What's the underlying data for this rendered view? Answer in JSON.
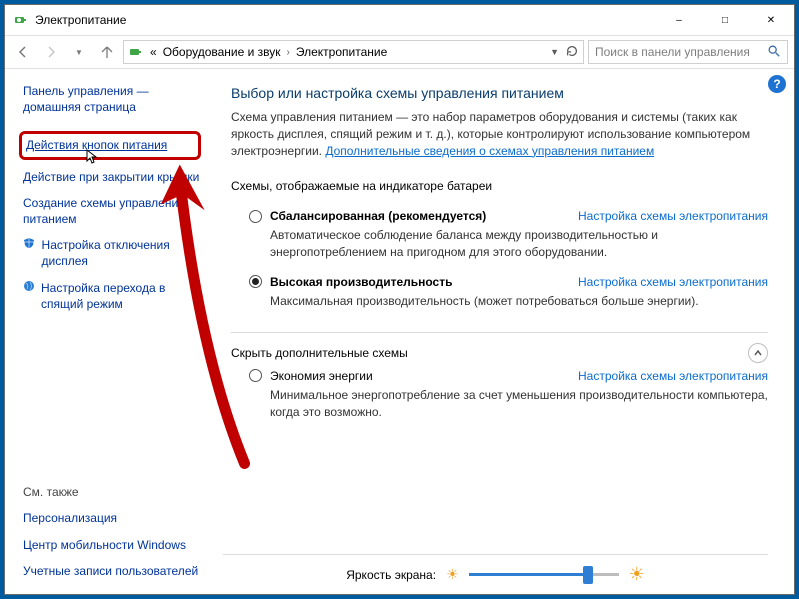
{
  "window": {
    "title": "Электропитание"
  },
  "addr": {
    "crumb_prefix": "«",
    "crumb1": "Оборудование и звук",
    "crumb2": "Электропитание",
    "search_placeholder": "Поиск в панели управления"
  },
  "sidebar": {
    "home": "Панель управления — домашняя страница",
    "links": [
      {
        "label": "Действия кнопок питания",
        "highlighted": true
      },
      {
        "label": "Действие при закрытии крышки"
      },
      {
        "label": "Создание схемы управления питанием"
      },
      {
        "label": "Настройка отключения дисплея",
        "icon": "shield"
      },
      {
        "label": "Настройка перехода в спящий режим",
        "icon": "globe"
      }
    ],
    "see_also_heading": "См. также",
    "see_also": [
      "Персонализация",
      "Центр мобильности Windows",
      "Учетные записи пользователей"
    ]
  },
  "main": {
    "title": "Выбор или настройка схемы управления питанием",
    "description": "Схема управления питанием — это набор параметров оборудования и системы (таких как яркость дисплея, спящий режим и т. д.), которые контролируют использование компьютером электроэнергии. ",
    "more_link": "Дополнительные сведения о схемах управления питанием",
    "section1": "Схемы, отображаемые на индикаторе батареи",
    "plan_link_label": "Настройка схемы электропитания",
    "plans_visible": [
      {
        "name": "Сбалансированная (рекомендуется)",
        "selected": false,
        "desc": "Автоматическое соблюдение баланса между производительностью и энергопотреблением на пригодном для этого оборудовании."
      },
      {
        "name": "Высокая производительность",
        "selected": true,
        "desc": "Максимальная производительность (может потребоваться больше энергии)."
      }
    ],
    "hide_label": "Скрыть дополнительные схемы",
    "plans_hidden": [
      {
        "name": "Экономия энергии",
        "selected": false,
        "desc": "Минимальное энергопотребление за счет уменьшения производительности компьютера, когда это возможно."
      }
    ],
    "brightness_label": "Яркость экрана:",
    "brightness_percent": 78
  }
}
